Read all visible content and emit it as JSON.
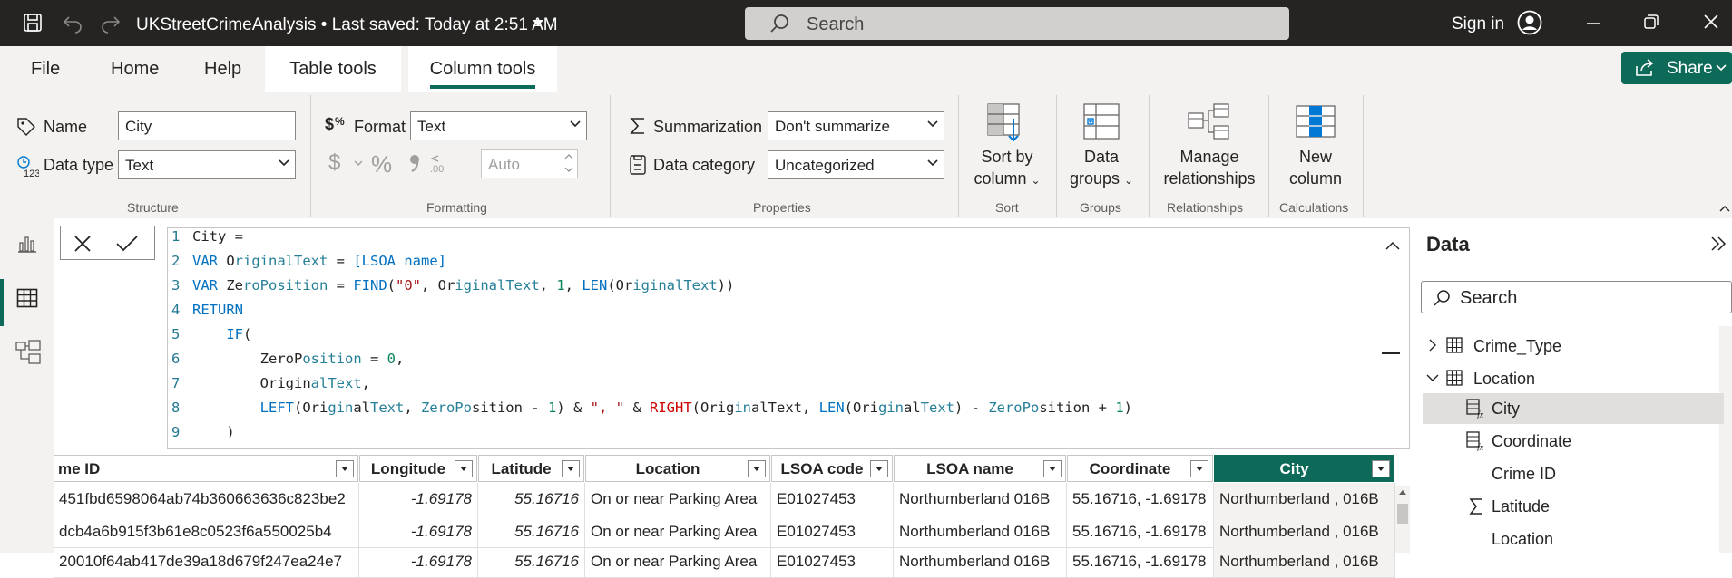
{
  "titlebar": {
    "title": "UKStreetCrimeAnalysis",
    "saved": "• Last saved: Today at 2:51 AM",
    "search_label": "Search",
    "sign_in": "Sign in"
  },
  "tabs": [
    {
      "label": "File"
    },
    {
      "label": "Home"
    },
    {
      "label": "Help"
    },
    {
      "label": "Table tools"
    },
    {
      "label": "Column tools"
    }
  ],
  "share_label": "Share",
  "ribbon": {
    "structure": {
      "name_label": "Name",
      "name_value": "City",
      "datatype_label": "Data type",
      "datatype_value": "Text",
      "group_label": "Structure"
    },
    "formatting": {
      "format_label": "Format",
      "format_value": "Text",
      "currency_symbol": "$",
      "percent_symbol": "%",
      "auto_value": "Auto",
      "group_label": "Formatting"
    },
    "properties": {
      "summarization_label": "Summarization",
      "summarization_value": "Don't summarize",
      "category_label": "Data category",
      "category_value": "Uncategorized",
      "group_label": "Properties"
    },
    "sort": {
      "btn_line1": "Sort by",
      "btn_line2": "column",
      "group_label": "Sort"
    },
    "groups": {
      "btn_line1": "Data",
      "btn_line2": "groups",
      "group_label": "Groups"
    },
    "relationships": {
      "btn_line1": "Manage",
      "btn_line2": "relationships",
      "group_label": "Relationships"
    },
    "calculations": {
      "btn_line1": "New",
      "btn_line2": "column",
      "group_label": "Calculations"
    }
  },
  "formula": {
    "line_numbers": [
      "1",
      "2",
      "3",
      "4",
      "5",
      "6",
      "7",
      "8",
      "9"
    ]
  },
  "table": {
    "columns": [
      {
        "label": "me ID"
      },
      {
        "label": "Longitude"
      },
      {
        "label": "Latitude"
      },
      {
        "label": "Location"
      },
      {
        "label": "LSOA code"
      },
      {
        "label": "LSOA name"
      },
      {
        "label": "Coordinate"
      },
      {
        "label": "City"
      }
    ],
    "rows": [
      [
        "451fbd6598064ab74b360663636c823be2",
        "-1.69178",
        "55.16716",
        "On or near Parking Area",
        "E01027453",
        "Northumberland 016B",
        "55.16716, -1.69178",
        "Northumberland , 016B"
      ],
      [
        "dcb4a6b915f3b61e8c0523f6a550025b4",
        "-1.69178",
        "55.16716",
        "On or near Parking Area",
        "E01027453",
        "Northumberland 016B",
        "55.16716, -1.69178",
        "Northumberland , 016B"
      ],
      [
        "20010f64ab417de39a18d679f247ea24e7",
        "-1.69178",
        "55.16716",
        "On or near Parking Area",
        "E01027453",
        "Northumberland 016B",
        "55.16716, -1.69178",
        "Northumberland , 016B"
      ]
    ]
  },
  "data_pane": {
    "title": "Data",
    "search_label": "Search",
    "items": [
      {
        "label": "Crime_Type"
      },
      {
        "label": "Location"
      },
      {
        "label": "City"
      },
      {
        "label": "Coordinate"
      },
      {
        "label": "Crime ID"
      },
      {
        "label": "Latitude"
      },
      {
        "label": "Location"
      }
    ]
  },
  "colors": {
    "accent": "#0e6a58",
    "titlebar": "#252423"
  }
}
